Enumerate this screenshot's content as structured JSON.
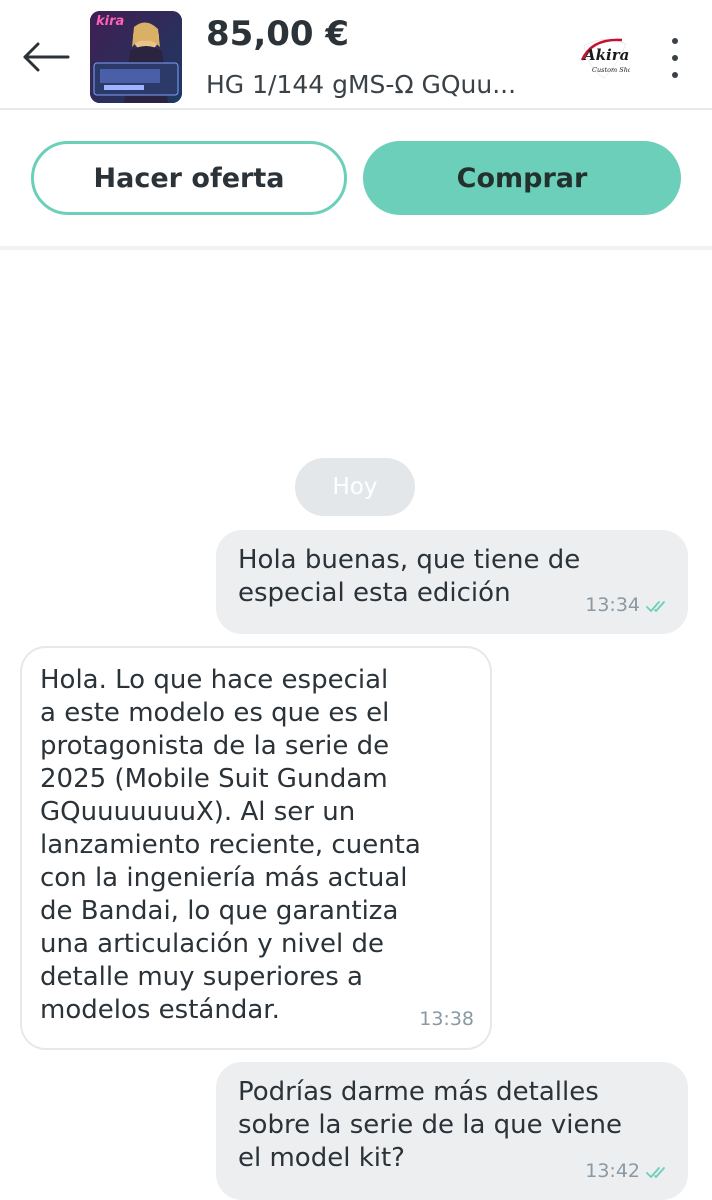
{
  "header": {
    "back_icon": "arrow-left-icon",
    "price": "85,00 €",
    "product_title": "HG 1/144 gMS-Ω GQuu...",
    "thumbnail_brand": "kira",
    "seller_logo_text": "Akira",
    "seller_logo_subtext": "Custom Shop",
    "menu_icon": "kebab-menu-icon"
  },
  "actions": {
    "offer_label": "Hacer oferta",
    "buy_label": "Comprar"
  },
  "colors": {
    "accent": "#6ccfb9",
    "outgoing_bubble": "#eceef0",
    "incoming_border": "#e6e8ea",
    "day_chip": "#e4e7ea",
    "read_check": "#6ccfb9"
  },
  "chat": {
    "day_label": "Hoy",
    "messages": [
      {
        "direction": "outgoing",
        "text": "Hola buenas, que tiene de\nespecial esta edición",
        "time": "13:34",
        "status_icon": "double-check-icon"
      },
      {
        "direction": "incoming",
        "text": "Hola. Lo que hace especial\na este modelo es que es el\nprotagonista de la serie de\n2025 (Mobile Suit Gundam\nGQuuuuuuuX). Al ser un\nlanzamiento reciente, cuenta\ncon la ingeniería más actual\nde Bandai, lo que garantiza\nuna articulación y nivel de\ndetalle muy superiores a\nmodelos estándar.",
        "time": "13:38"
      },
      {
        "direction": "outgoing",
        "text": "Podrías darme más detalles\nsobre la serie de la que viene\nel model kit?",
        "time": "13:42",
        "status_icon": "double-check-icon"
      }
    ]
  }
}
